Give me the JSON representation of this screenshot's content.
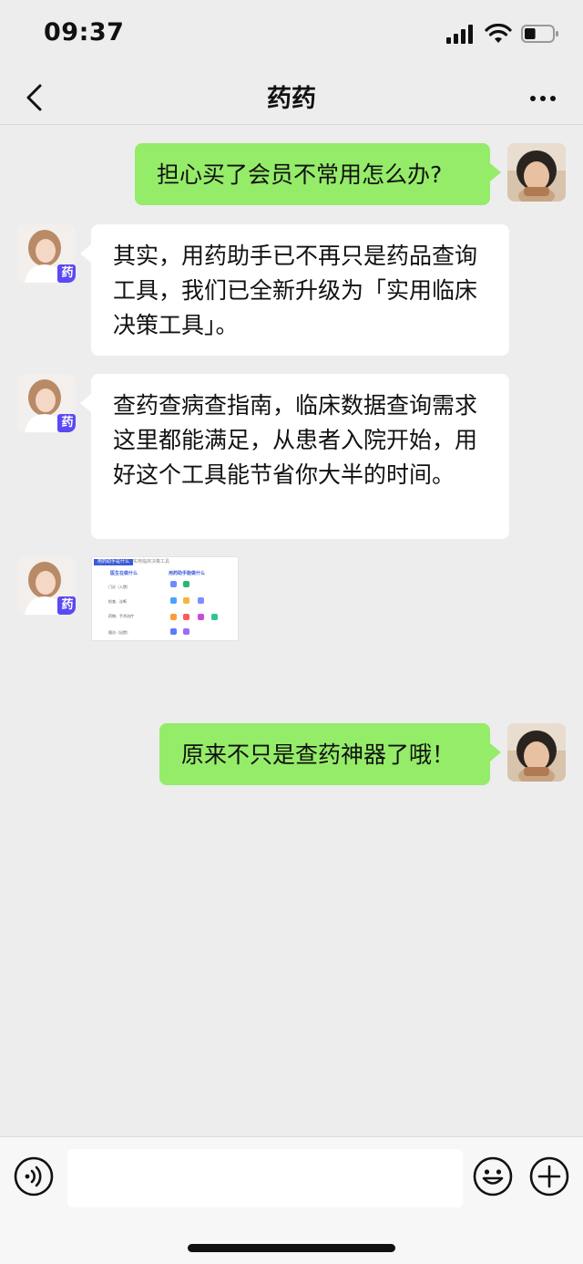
{
  "status_bar": {
    "time": "09:37",
    "battery_level": 0.4
  },
  "nav": {
    "title": "药药",
    "back_icon": "chevron-left-icon",
    "more_icon": "more-dots-icon"
  },
  "messages": [
    {
      "side": "out",
      "text": "担心买了会员不常用怎么办?"
    },
    {
      "side": "in",
      "text": "其实，用药助手已不再只是药品查询工具，我们已全新升级为「实用临床决策工具」。"
    },
    {
      "side": "in",
      "text": "查药查病查指南，临床数据查询需求这里都能满足，从患者入院开始，用好这个工具能节省你大半的时间。"
    },
    {
      "side": "in",
      "type": "image",
      "image": {
        "header_tag": "用药助手是什么",
        "header_caption": "实用临床决策工具",
        "left_title": "医生在做什么",
        "right_title": "用药助手能做什么",
        "steps": [
          "门诊（入院）",
          "检查、诊断",
          "药物、手术治疗",
          "随访（出院）"
        ]
      }
    },
    {
      "side": "out",
      "text": "原来不只是查药神器了哦！"
    }
  ],
  "avatars": {
    "bot_badge": "药"
  },
  "input": {
    "placeholder": ""
  },
  "colors": {
    "outgoing_bubble": "#95ec69",
    "incoming_bubble": "#ffffff",
    "background": "#ededed",
    "badge": "#5b49f5"
  }
}
